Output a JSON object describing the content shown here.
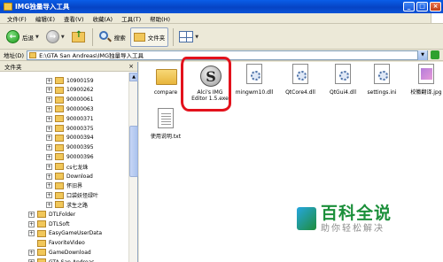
{
  "window": {
    "title": "IMG独量导入工具",
    "minimize": "_",
    "maximize": "□",
    "close": "×"
  },
  "menu": [
    "文件(F)",
    "编辑(E)",
    "查看(V)",
    "收藏(A)",
    "工具(T)",
    "帮助(H)"
  ],
  "toolbar": {
    "back": "后退",
    "search": "搜索",
    "folders": "文件夹"
  },
  "address": {
    "label": "地址(D)",
    "path": "E:\\GTA San Andreas\\IMG独量导入工具"
  },
  "left_pane": {
    "header": "文件夹",
    "close": "×",
    "tree": [
      {
        "label": "10900159",
        "level": 2,
        "expander": "+"
      },
      {
        "label": "10900262",
        "level": 2,
        "expander": "+"
      },
      {
        "label": "90000061",
        "level": 2,
        "expander": "+"
      },
      {
        "label": "90000063",
        "level": 2,
        "expander": "+"
      },
      {
        "label": "90000371",
        "level": 2,
        "expander": "+"
      },
      {
        "label": "90000375",
        "level": 2,
        "expander": "+"
      },
      {
        "label": "90000394",
        "level": 2,
        "expander": "+"
      },
      {
        "label": "90000395",
        "level": 2,
        "expander": "+"
      },
      {
        "label": "90000396",
        "level": 2,
        "expander": "+"
      },
      {
        "label": "cs七龙珠",
        "level": 2,
        "expander": "+"
      },
      {
        "label": "Download",
        "level": 2,
        "expander": "+"
      },
      {
        "label": "怀旧界",
        "level": 2,
        "expander": "+"
      },
      {
        "label": "口袋妖怪绿叶",
        "level": 2,
        "expander": "+"
      },
      {
        "label": "求生之路",
        "level": 2,
        "expander": "+"
      },
      {
        "label": "DTLFolder",
        "level": 1,
        "expander": "+"
      },
      {
        "label": "DTLSoft",
        "level": 1,
        "expander": "+"
      },
      {
        "label": "EasyGameUserData",
        "level": 1,
        "expander": "+"
      },
      {
        "label": "FavoriteVideo",
        "level": 1,
        "expander": ""
      },
      {
        "label": "GameDownload",
        "level": 1,
        "expander": "+"
      },
      {
        "label": "GTA San Andreas",
        "level": 1,
        "expander": "+"
      }
    ]
  },
  "files": [
    {
      "name": "compare",
      "type": "folder"
    },
    {
      "name": "Alci's IMG Editor 1.5.exe",
      "type": "exe",
      "icon_letter": "S"
    },
    {
      "name": "mingwm10.dll",
      "type": "dll"
    },
    {
      "name": "QtCore4.dll",
      "type": "dll"
    },
    {
      "name": "QtGui4.dll",
      "type": "dll"
    },
    {
      "name": "settings.ini",
      "type": "ini"
    },
    {
      "name": "校徽翻译.jpg",
      "type": "jpg"
    },
    {
      "name": "使用说明.txt",
      "type": "txt"
    }
  ],
  "watermark": {
    "title": "百科全说",
    "subtitle": "助你轻松解决"
  },
  "colors": {
    "titlebar": "#0a54d8",
    "highlight_circle": "#e3121c",
    "watermark_green": "#1b8f3a"
  }
}
